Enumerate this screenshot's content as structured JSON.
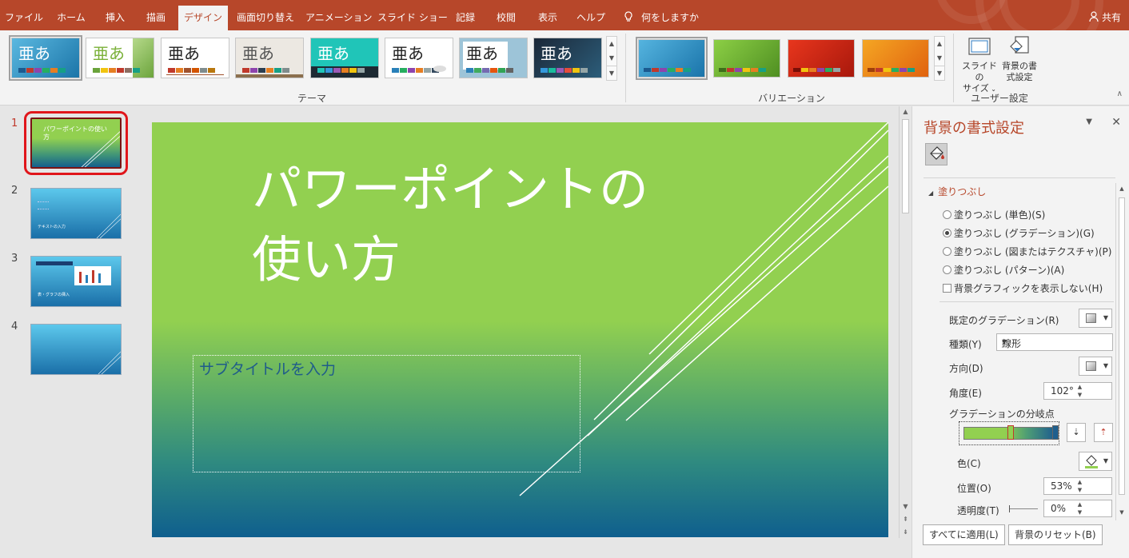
{
  "ribbon": {
    "tabs": [
      "ファイル",
      "ホーム",
      "挿入",
      "描画",
      "デザイン",
      "画面切り替え",
      "アニメーション",
      "スライド ショー",
      "記録",
      "校閲",
      "表示",
      "ヘルプ"
    ],
    "active_tab": "デザイン",
    "tell_me": "何をしますか",
    "share": "共有",
    "theme_glyph": "亜あ",
    "groups": {
      "themes": "テーマ",
      "variants": "バリエーション",
      "customize": "ユーザー設定"
    },
    "slide_size_line1": "スライドの",
    "slide_size_line2": "サイズ",
    "format_bg_line1": "背景の書",
    "format_bg_line2": "式設定"
  },
  "colors": {
    "brand": "#b7472a",
    "slide_green": "#92d050",
    "slide_blue": "#0f5f8e",
    "selection_red": "#e0161b"
  },
  "thumbnails": [
    {
      "number": "1",
      "title": "パワーポイントの使い方"
    },
    {
      "number": "2",
      "line": "テキストの入力"
    },
    {
      "number": "3",
      "line": "表・グラフの挿入"
    },
    {
      "number": "4"
    }
  ],
  "slide": {
    "title_line1": "パワーポイントの",
    "title_line2": "使い方",
    "subtitle_placeholder": "サブタイトルを入力"
  },
  "pane": {
    "title": "背景の書式設定",
    "section": "塗りつぶし",
    "fill_options": [
      "塗りつぶし (単色)(S)",
      "塗りつぶし (グラデーション)(G)",
      "塗りつぶし (図またはテクスチャ)(P)",
      "塗りつぶし (パターン)(A)"
    ],
    "hide_bg_graphics": "背景グラフィックを表示しない(H)",
    "preset_gradient_label": "既定のグラデーション(R)",
    "type_label": "種類(Y)",
    "type_value": "線形",
    "direction_label": "方向(D)",
    "angle_label": "角度(E)",
    "angle_value": "102°",
    "gradient_stops_label": "グラデーションの分岐点",
    "color_label": "色(C)",
    "position_label": "位置(O)",
    "position_value": "53%",
    "transparency_label": "透明度(T)",
    "transparency_value": "0%",
    "apply_all": "すべてに適用(L)",
    "reset_bg": "背景のリセット(B)"
  }
}
